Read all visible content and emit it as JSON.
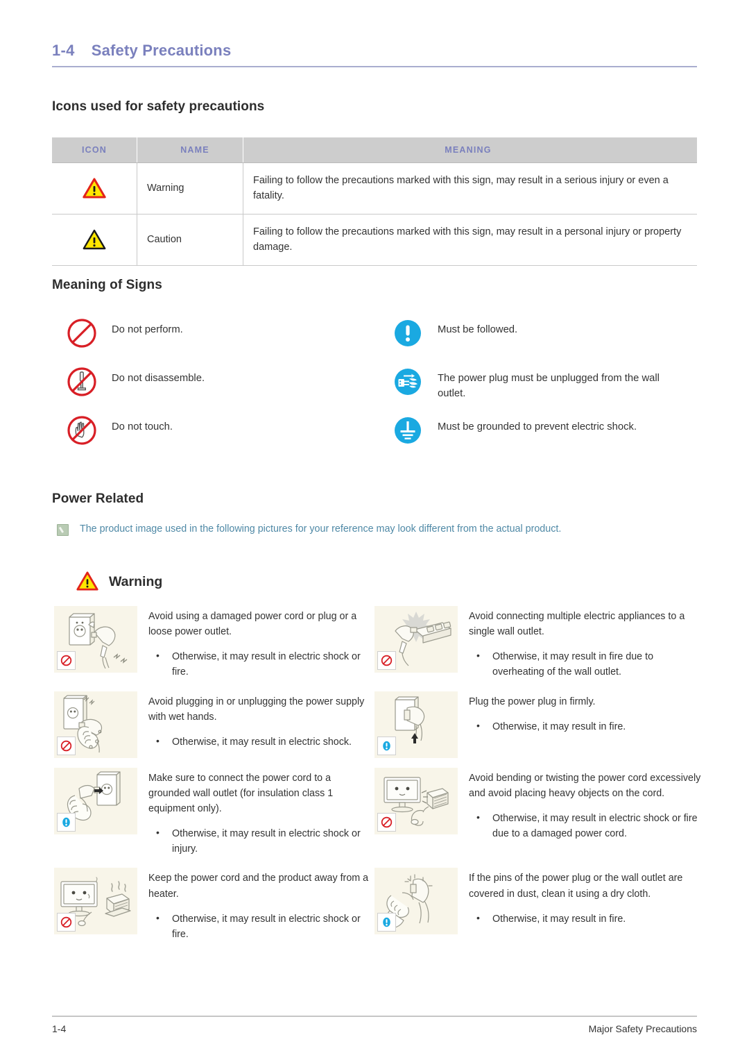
{
  "header": {
    "chapter_number": "1-4",
    "chapter_title": "Safety Precautions"
  },
  "sections": {
    "icons_heading": "Icons used for safety precautions",
    "signs_heading": "Meaning of Signs",
    "power_heading": "Power Related"
  },
  "icon_table": {
    "columns": [
      "ICON",
      "NAME",
      "MEANING"
    ],
    "rows": [
      {
        "icon": "warning-triangle-red-icon",
        "name": "Warning",
        "meaning": "Failing to follow the precautions marked with this sign, may result in a serious injury or even a fatality."
      },
      {
        "icon": "caution-triangle-black-icon",
        "name": "Caution",
        "meaning": "Failing to follow the precautions marked with this sign, may result in a personal injury or property damage."
      }
    ]
  },
  "signs": [
    {
      "icon": "prohibition-circle-icon",
      "text": "Do not perform."
    },
    {
      "icon": "mandatory-exclamation-icon",
      "text": "Must be followed."
    },
    {
      "icon": "do-not-disassemble-icon",
      "text": "Do not disassemble."
    },
    {
      "icon": "unplug-power-icon",
      "text": "The power plug must be unplugged from the wall outlet."
    },
    {
      "icon": "do-not-touch-icon",
      "text": "Do not touch."
    },
    {
      "icon": "grounding-icon",
      "text": "Must be grounded to prevent electric shock."
    }
  ],
  "note": {
    "icon": "note-clip-icon",
    "text": "The product image used in the following pictures for your reference may look different from the actual product."
  },
  "warning_banner": {
    "icon": "warning-triangle-red-icon",
    "label": "Warning"
  },
  "warning_items": [
    {
      "figure": "damaged-plug-outlet-illustration",
      "badge": "prohibition-badge",
      "title": "Avoid using a damaged power cord or plug or a loose power outlet.",
      "bullets": [
        "Otherwise, it may result in electric shock or fire."
      ]
    },
    {
      "figure": "multi-outlet-overload-illustration",
      "badge": "prohibition-badge",
      "title": "Avoid connecting multiple electric appliances to a single wall outlet.",
      "bullets": [
        "Otherwise, it may result in fire due to overheating of the wall outlet."
      ]
    },
    {
      "figure": "wet-hands-plug-illustration",
      "badge": "prohibition-badge",
      "title": "Avoid plugging in or unplugging the power supply with wet hands.",
      "bullets": [
        "Otherwise, it may result in electric shock."
      ]
    },
    {
      "figure": "plug-in-firmly-illustration",
      "badge": "mandatory-badge",
      "title": "Plug the power plug in firmly.",
      "bullets": [
        "Otherwise, it may result in fire."
      ]
    },
    {
      "figure": "grounded-outlet-illustration",
      "badge": "mandatory-badge",
      "title": "Make sure to connect the power cord to a grounded wall outlet (for insulation class 1 equipment only).",
      "bullets": [
        "Otherwise, it may result in electric shock or injury."
      ]
    },
    {
      "figure": "bent-cord-heavy-object-illustration",
      "badge": "prohibition-badge",
      "title": "Avoid bending or twisting the power cord excessively and avoid placing heavy objects on the cord.",
      "bullets": [
        "Otherwise, it may result in electric shock or fire due to a damaged power cord."
      ]
    },
    {
      "figure": "monitor-near-heater-illustration",
      "badge": "prohibition-badge",
      "title": "Keep the power cord and the product away from a heater.",
      "bullets": [
        "Otherwise, it may result in electric shock or fire."
      ]
    },
    {
      "figure": "clean-dusty-plug-illustration",
      "badge": "mandatory-badge",
      "title": "If the pins of the power plug or the wall outlet are covered in dust, clean it using a dry cloth.",
      "bullets": [
        "Otherwise, it may result in fire."
      ]
    }
  ],
  "footer": {
    "page_number": "1-4",
    "section_name": "Major Safety Precautions"
  },
  "colors": {
    "accent_purple": "#7a80bd",
    "table_header_bg": "#cdcdcd",
    "note_text": "#4f89a6",
    "figure_bg": "#f8f5e9",
    "prohibition_red": "#d81f26",
    "mandatory_blue": "#1aa9e1",
    "warning_yellow": "#ffe600"
  }
}
